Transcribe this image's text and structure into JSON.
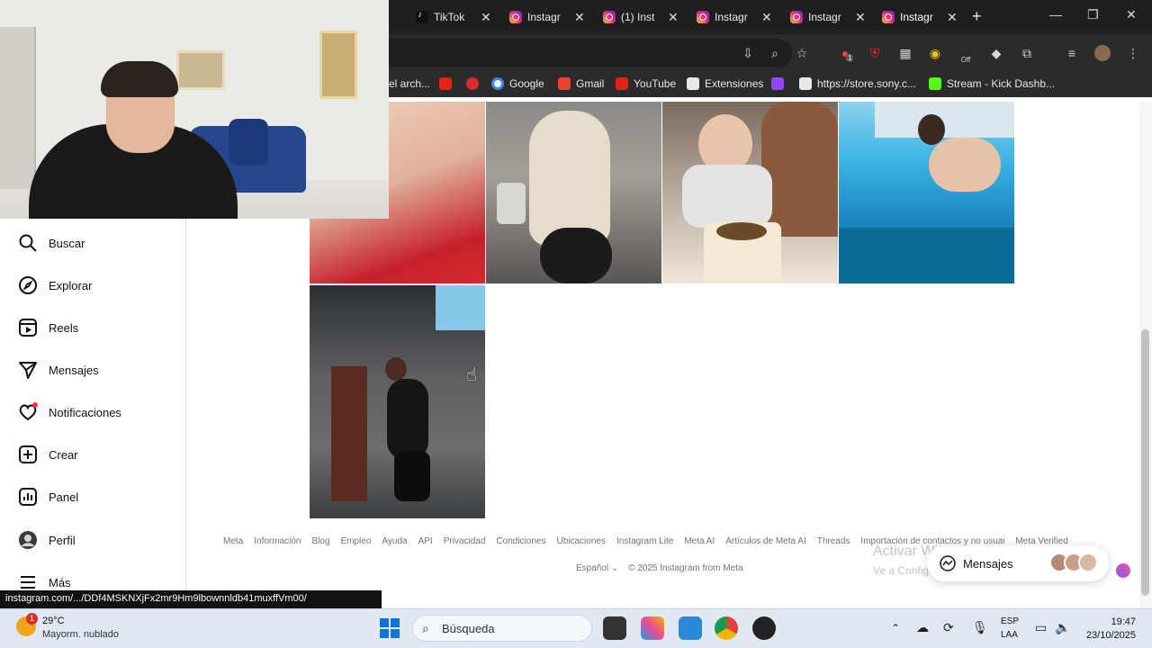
{
  "browser": {
    "tabs": [
      {
        "title": "TikTok",
        "kind": "tiktok"
      },
      {
        "title": "Instagr",
        "kind": "instagram"
      },
      {
        "title": "(1) Insta",
        "kind": "instagram"
      },
      {
        "title": "Instagr",
        "kind": "instagram"
      },
      {
        "title": "Instagr",
        "kind": "instagram"
      },
      {
        "title": "Instagr",
        "kind": "instagram",
        "active": true
      }
    ],
    "new_tab": "+",
    "window_controls": {
      "minimize": "—",
      "restore": "❐",
      "close": "✕"
    },
    "extension_badges": {
      "ext1_count": "1",
      "ext_off": "Off"
    },
    "bookmarks": [
      {
        "label": "el arch...",
        "icon": "folder-icon"
      },
      {
        "label": "",
        "icon": "youtube-icon"
      },
      {
        "label": "",
        "icon": "app-icon"
      },
      {
        "label": "Google",
        "icon": "google-icon"
      },
      {
        "label": "Gmail",
        "icon": "gmail-icon"
      },
      {
        "label": "YouTube",
        "icon": "youtube-icon"
      },
      {
        "label": "Extensiones",
        "icon": "puzzle-icon"
      },
      {
        "label": "",
        "icon": "twitch-icon"
      },
      {
        "label": "https://store.sony.c...",
        "icon": "sony-icon"
      },
      {
        "label": "Stream - Kick Dashb...",
        "icon": "kick-icon"
      }
    ]
  },
  "sidebar": {
    "items": [
      {
        "label": "Buscar",
        "icon": "search-icon"
      },
      {
        "label": "Explorar",
        "icon": "compass-icon"
      },
      {
        "label": "Reels",
        "icon": "reels-icon"
      },
      {
        "label": "Mensajes",
        "icon": "send-icon"
      },
      {
        "label": "Notificaciones",
        "icon": "heart-icon"
      },
      {
        "label": "Crear",
        "icon": "plus-square-icon"
      },
      {
        "label": "Panel",
        "icon": "chart-icon"
      },
      {
        "label": "Perfil",
        "icon": "avatar-icon"
      },
      {
        "label": "Más",
        "icon": "menu-icon"
      }
    ]
  },
  "footer": {
    "links": [
      "Meta",
      "Información",
      "Blog",
      "Empleo",
      "Ayuda",
      "API",
      "Privacidad",
      "Condiciones",
      "Ubicaciones",
      "Instagram Lite",
      "Meta AI",
      "Artículos de Meta AI",
      "Threads",
      "Importación de contactos y no usuarios",
      "Meta Verified"
    ],
    "language": "Español",
    "copyright": "© 2025 Instagram from Meta"
  },
  "windows_watermark": {
    "line1": "Activar Windows",
    "line2": "Ve a Configuración para activar Windows."
  },
  "messages_pill": {
    "label": "Mensajes"
  },
  "status_url": "instagram.com/.../DDf4MSKNXjFx2mr9Hm9lbownnldb41muxffVm00/",
  "taskbar": {
    "weather_temp": "29°C",
    "weather_desc": "Mayorm. nublado",
    "weather_badge": "1",
    "search_placeholder": "Búsqueda",
    "lang": "ESP",
    "lang_sub": "LAA",
    "time": "19:47",
    "date": "23/10/2025"
  },
  "colors": {
    "chrome_dark": "#1f1f1f",
    "toolbar": "#2b2b2b",
    "instagram_accent": "#ee2a7b",
    "taskbar": "#dfe8f3"
  }
}
